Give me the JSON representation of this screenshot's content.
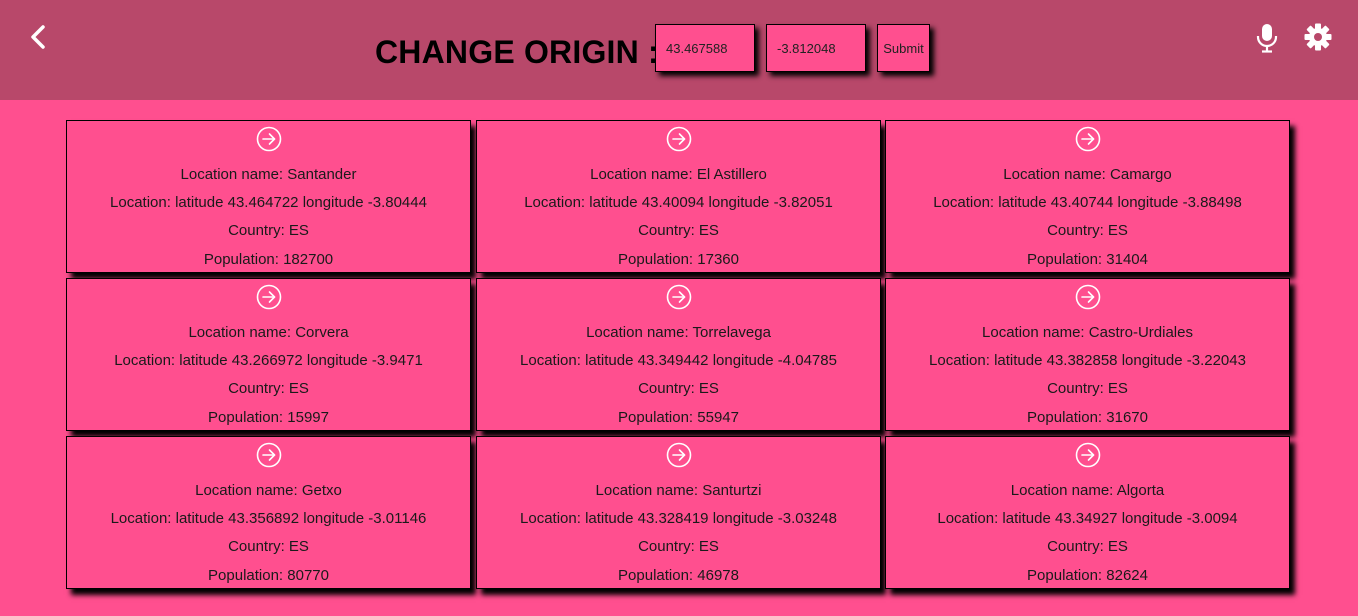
{
  "header": {
    "title": "CHANGE ORIGIN :",
    "latitude_value": "43.467588",
    "longitude_value": "-3.812048",
    "submit_label": "Submit",
    "icons": [
      "chevron-left-icon",
      "microphone-icon",
      "gear-icon"
    ]
  },
  "colors": {
    "page_background": "#ff4f8f",
    "header_background": "#b8486a",
    "card_background": "#ff4f8f",
    "icon_color": "#ffffff"
  },
  "cards": [
    {
      "name": "Location name: Santander",
      "location": "Location: latitude 43.464722 longitude -3.80444",
      "country": "Country: ES",
      "population": "Population: 182700"
    },
    {
      "name": "Location name: El Astillero",
      "location": "Location: latitude 43.40094 longitude -3.82051",
      "country": "Country: ES",
      "population": "Population: 17360"
    },
    {
      "name": "Location name: Camargo",
      "location": "Location: latitude 43.40744 longitude -3.88498",
      "country": "Country: ES",
      "population": "Population: 31404"
    },
    {
      "name": "Location name: Corvera",
      "location": "Location: latitude 43.266972 longitude -3.9471",
      "country": "Country: ES",
      "population": "Population: 15997"
    },
    {
      "name": "Location name: Torrelavega",
      "location": "Location: latitude 43.349442 longitude -4.04785",
      "country": "Country: ES",
      "population": "Population: 55947"
    },
    {
      "name": "Location name: Castro-Urdiales",
      "location": "Location: latitude 43.382858 longitude -3.22043",
      "country": "Country: ES",
      "population": "Population: 31670"
    },
    {
      "name": "Location name: Getxo",
      "location": "Location: latitude 43.356892 longitude -3.01146",
      "country": "Country: ES",
      "population": "Population: 80770"
    },
    {
      "name": "Location name: Santurtzi",
      "location": "Location: latitude 43.328419 longitude -3.03248",
      "country": "Country: ES",
      "population": "Population: 46978"
    },
    {
      "name": "Location name: Algorta",
      "location": "Location: latitude 43.34927 longitude -3.0094",
      "country": "Country: ES",
      "population": "Population: 82624"
    }
  ]
}
